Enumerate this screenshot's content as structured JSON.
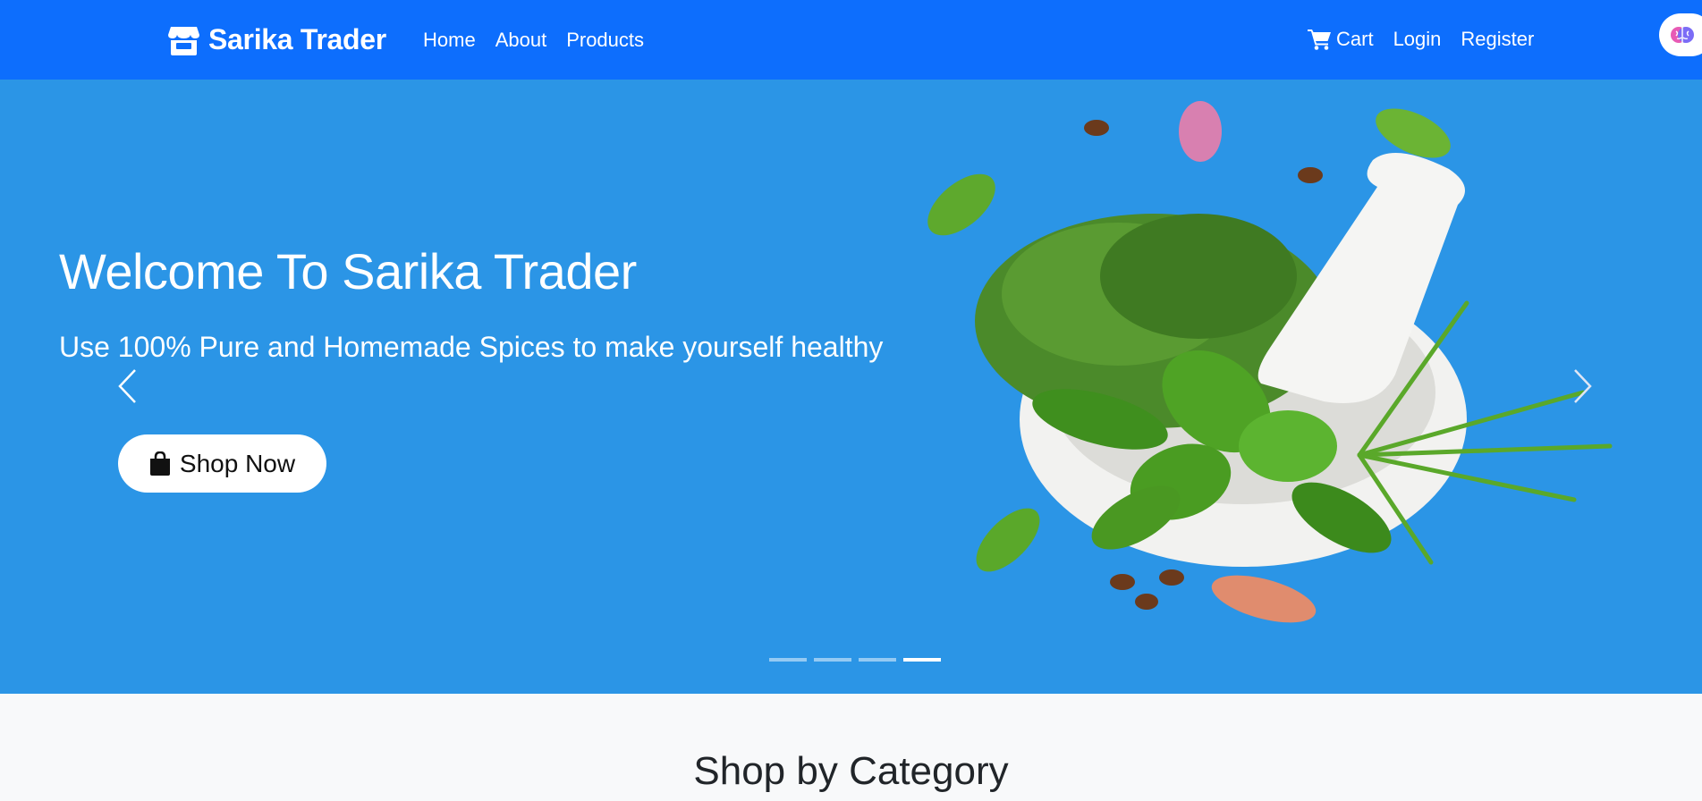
{
  "navbar": {
    "brand": "Sarika Trader",
    "brand_icon": "store-icon",
    "links": [
      "Home",
      "About",
      "Products"
    ],
    "right": {
      "cart": "Cart",
      "cart_icon": "cart-icon",
      "login": "Login",
      "register": "Register"
    },
    "extension_icon": "brain-icon",
    "color": "#0d6efd"
  },
  "hero": {
    "title": "Welcome To Sarika Trader",
    "subtitle": "Use 100% Pure and Homemade Spices to make yourself healthy",
    "button_label": "Shop Now",
    "button_icon": "shopping-bag-icon",
    "background_color": "#2b95e6",
    "prev_icon": "chevron-left-icon",
    "next_icon": "chevron-right-icon",
    "slide_count": 4,
    "active_slide": 4
  },
  "section": {
    "title": "Shop by Category"
  }
}
